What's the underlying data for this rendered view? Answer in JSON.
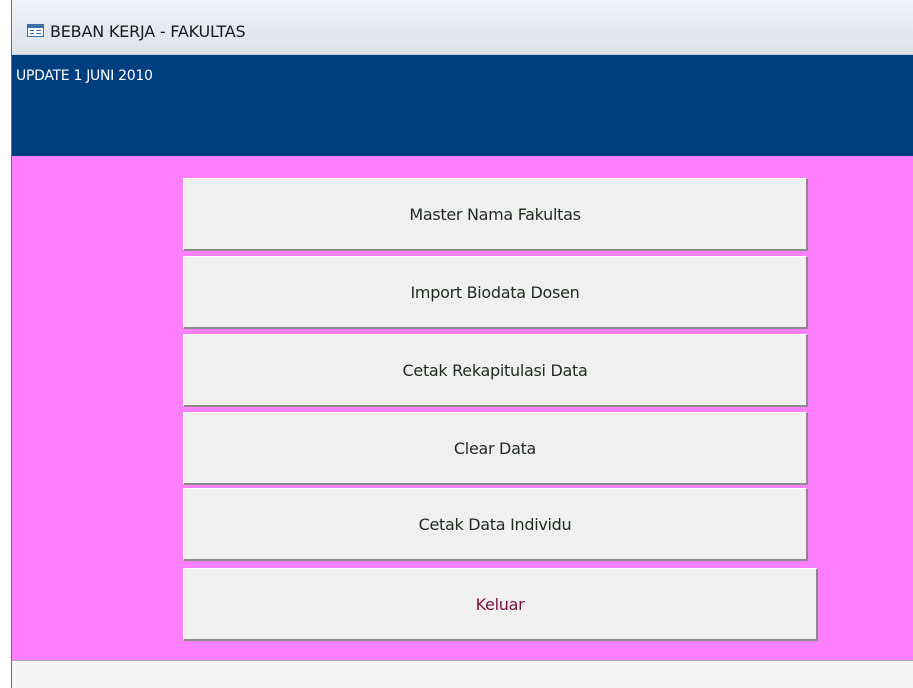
{
  "window": {
    "title": "BEBAN KERJA - FAKULTAS",
    "icon": "form-icon"
  },
  "header": {
    "update_text": "UPDATE 1 JUNI 2010",
    "background_color": "#003f7f"
  },
  "detail": {
    "background_color": "#ff80ff"
  },
  "menu": {
    "buttons": [
      {
        "label": "Master Nama Fakultas"
      },
      {
        "label": "Import Biodata Dosen"
      },
      {
        "label": "Cetak Rekapitulasi Data"
      },
      {
        "label": "Clear Data"
      },
      {
        "label": "Cetak Data Individu"
      },
      {
        "label": "Keluar",
        "color": "#7a1040"
      }
    ]
  }
}
